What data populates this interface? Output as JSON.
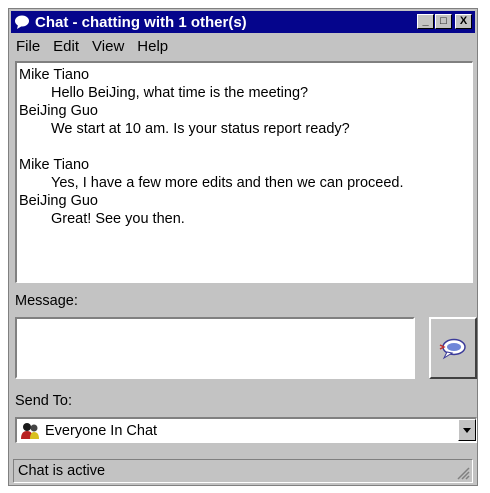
{
  "window": {
    "title": "Chat - chatting with 1 other(s)",
    "minimize_label": "_",
    "maximize_label": "□",
    "close_label": "X"
  },
  "menu": [
    "File",
    "Edit",
    "View",
    "Help"
  ],
  "chat_log": [
    {
      "sender": "Mike Tiano",
      "text": "Hello BeiJing, what time is the meeting?"
    },
    {
      "sender": "BeiJing Guo",
      "text": "We start at 10 am. Is your status report ready?"
    },
    {
      "sender": "Mike Tiano",
      "text": "Yes, I have a few more edits and then we can proceed."
    },
    {
      "sender": "BeiJing Guo",
      "text": "Great! See you then."
    }
  ],
  "message": {
    "label": "Message:",
    "value": ""
  },
  "send_to": {
    "label": "Send To:",
    "selected": "Everyone In Chat"
  },
  "status": "Chat is active",
  "colors": {
    "titlebar": "#05058c",
    "face": "#c3c3c3"
  },
  "icons": {
    "title": "chat-bubble-icon",
    "send": "send-message-icon",
    "recipients": "people-group-icon",
    "dropdown": "triangle-down-icon",
    "grip": "resize-grip-icon"
  }
}
